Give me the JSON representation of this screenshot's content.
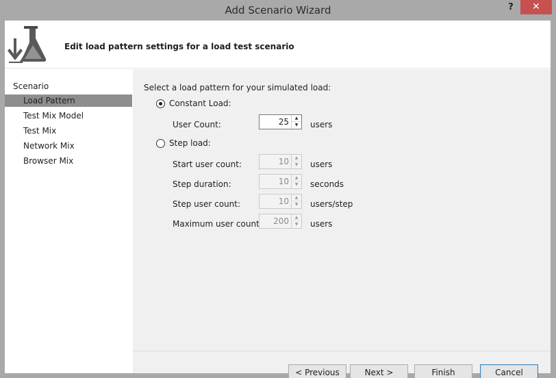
{
  "window": {
    "title": "Add Scenario Wizard",
    "help_label": "?",
    "close_label": "✕"
  },
  "header": {
    "text": "Edit load pattern settings for a load test scenario"
  },
  "nav": {
    "root": "Scenario",
    "items": [
      {
        "label": "Load Pattern",
        "selected": true
      },
      {
        "label": "Test Mix Model",
        "selected": false
      },
      {
        "label": "Test Mix",
        "selected": false
      },
      {
        "label": "Network Mix",
        "selected": false
      },
      {
        "label": "Browser Mix",
        "selected": false
      }
    ]
  },
  "content": {
    "prompt": "Select a load pattern for your simulated load:",
    "constant": {
      "label": "Constant Load:",
      "selected": true,
      "user_count_label": "User Count:",
      "user_count": "25",
      "user_count_unit": "users"
    },
    "step": {
      "label": "Step load:",
      "selected": false,
      "fields": [
        {
          "label": "Start user count:",
          "value": "10",
          "unit": "users"
        },
        {
          "label": "Step duration:",
          "value": "10",
          "unit": "seconds"
        },
        {
          "label": "Step user count:",
          "value": "10",
          "unit": "users/step"
        },
        {
          "label": "Maximum user count:",
          "value": "200",
          "unit": "users"
        }
      ]
    }
  },
  "buttons": {
    "previous": "< Previous",
    "next": "Next >",
    "finish": "Finish",
    "cancel": "Cancel"
  },
  "colors": {
    "accent_selected": "#8e8e8e",
    "close_button": "#c75050",
    "default_button_border": "#3c7fb1"
  }
}
